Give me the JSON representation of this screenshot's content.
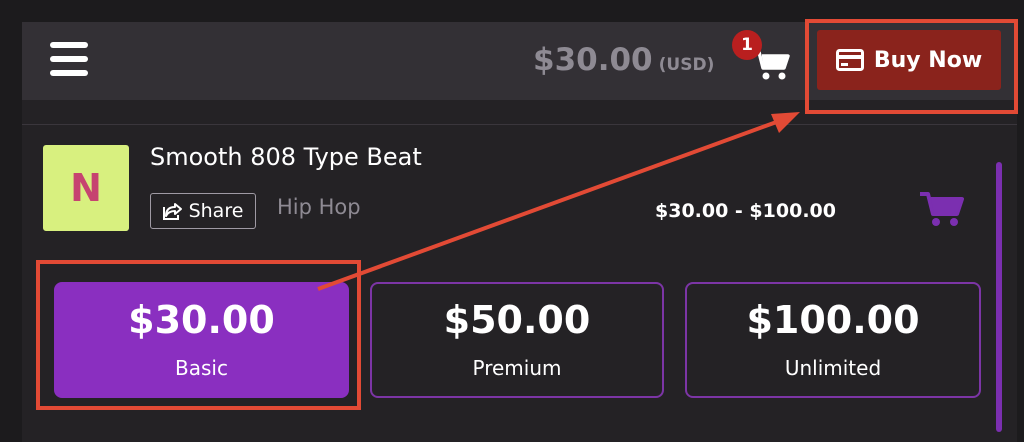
{
  "header": {
    "total_price": "$30.00",
    "currency": "(USD)",
    "cart_count": "1",
    "buy_label": "Buy Now"
  },
  "track": {
    "thumbnail_letter": "N",
    "title": "Smooth 808 Type Beat",
    "share_label": "Share",
    "genre": "Hip Hop",
    "price_range": "$30.00 - $100.00"
  },
  "licenses": [
    {
      "price": "$30.00",
      "tier": "Basic",
      "selected": true
    },
    {
      "price": "$50.00",
      "tier": "Premium",
      "selected": false
    },
    {
      "price": "$100.00",
      "tier": "Unlimited",
      "selected": false
    }
  ],
  "colors": {
    "accent_purple": "#8a2fc0",
    "buy_button": "#8a231c",
    "annotation": "#e24a35",
    "badge": "#b91f1f"
  },
  "icons": [
    "hamburger-icon",
    "cart-icon",
    "credit-card-icon",
    "share-icon",
    "cart-purple-icon"
  ]
}
